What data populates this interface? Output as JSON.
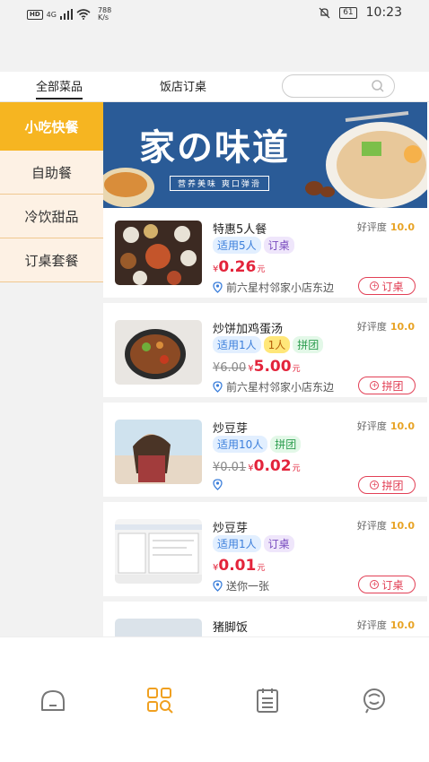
{
  "status_bar": {
    "hd": "HD",
    "net": "4G",
    "speed_value": "788",
    "speed_unit": "K/s",
    "battery": "61",
    "time": "10:23"
  },
  "tabs": [
    {
      "label": "全部菜品"
    },
    {
      "label": "饭店订桌"
    }
  ],
  "search": {
    "placeholder": ""
  },
  "sidebar": {
    "items": [
      {
        "label": "小吃快餐"
      },
      {
        "label": "自助餐"
      },
      {
        "label": "冷饮甜品"
      },
      {
        "label": "订桌套餐"
      }
    ]
  },
  "banner": {
    "title": "家の味道",
    "subtitle": "营养美味 爽口弹滑"
  },
  "rating_label": "好评度",
  "currency": "¥",
  "price_unit": "元",
  "dishes": [
    {
      "title": "特惠5人餐",
      "rating": "10.0",
      "tags": [
        "适用5人",
        "订桌"
      ],
      "old_price": "",
      "price": "0.26",
      "address": "前六星村邻家小店东边",
      "action": "订桌"
    },
    {
      "title": "炒饼加鸡蛋汤",
      "rating": "10.0",
      "tags": [
        "适用1人",
        "1人",
        "拼团"
      ],
      "old_price": "6.00",
      "price": "5.00",
      "address": "前六星村邻家小店东边",
      "action": "拼团"
    },
    {
      "title": "炒豆芽",
      "rating": "10.0",
      "tags": [
        "适用10人",
        "拼团"
      ],
      "old_price": "0.01",
      "price": "0.02",
      "address": "",
      "action": "拼团"
    },
    {
      "title": "炒豆芽",
      "rating": "10.0",
      "tags": [
        "适用1人",
        "订桌"
      ],
      "old_price": "",
      "price": "0.01",
      "address": "送你一张",
      "action": "订桌"
    },
    {
      "title": "猪脚饭",
      "rating": "10.0",
      "tags": [],
      "old_price": "",
      "price": "",
      "address": "",
      "action": ""
    }
  ],
  "bottom_nav": [
    {
      "icon": "home-icon"
    },
    {
      "icon": "category-search-icon"
    },
    {
      "icon": "orders-icon"
    },
    {
      "icon": "profile-icon"
    }
  ],
  "colors": {
    "accent": "#f6b521",
    "price": "#e3243b",
    "rating": "#e8a325"
  }
}
